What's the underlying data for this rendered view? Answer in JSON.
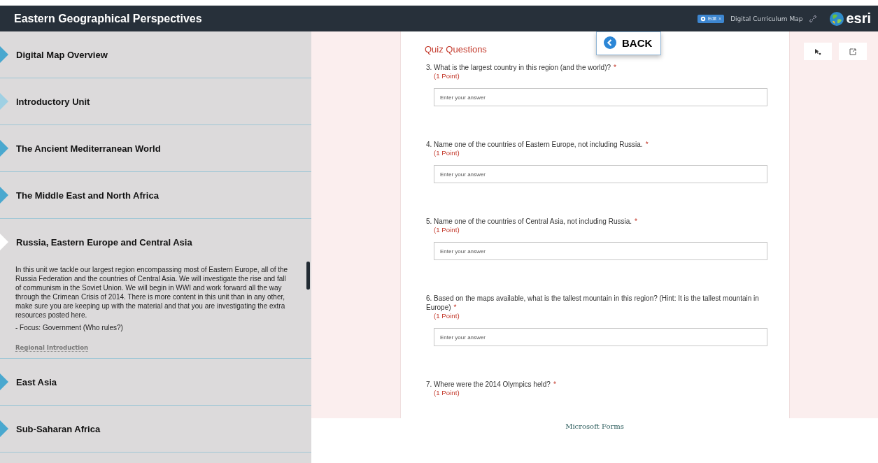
{
  "header": {
    "title": "Eastern Geographical Perspectives",
    "edit_button": "Edit",
    "edit_close": "×",
    "map_link": "Digital Curriculum Map",
    "logo": "esri"
  },
  "sidebar": {
    "items": [
      {
        "label": "Digital Map Overview",
        "color": "#4aa8cf",
        "expanded": false
      },
      {
        "label": "Introductory Unit",
        "color": "#9fd0e3",
        "expanded": false
      },
      {
        "label": "The Ancient Mediterranean World",
        "color": "#4aa8cf",
        "expanded": false
      },
      {
        "label": "The Middle East and North Africa",
        "color": "#4aa8cf",
        "expanded": false
      },
      {
        "label": "Russia, Eastern Europe and Central Asia",
        "color": "#ffffff",
        "expanded": true,
        "description": "In this unit we tackle our largest region encompassing most of Eastern Europe, all of the Russia Federation and the countries of Central Asia. We will investigate the rise and fall of communism in the Soviet Union. We will begin in WWI and work forward all the way through the Crimean Crisis of 2014. There is more content in this unit than in any other, make sure you are keeping up with the material and that you are investigating the extra resources posted here.",
        "focus": "- Focus: Government (Who rules?)",
        "link": "Regional Introduction"
      },
      {
        "label": "East Asia",
        "color": "#4aa8cf",
        "expanded": false
      },
      {
        "label": "Sub-Saharan Africa",
        "color": "#4aa8cf",
        "expanded": false
      }
    ]
  },
  "back_button": "BACK",
  "form": {
    "section_title": "Quiz Questions",
    "questions": [
      {
        "number": "3.",
        "text": "What is the largest country in this region (and the world)?",
        "required_mark": "*",
        "points": "(1 Point)",
        "placeholder": "Enter your answer"
      },
      {
        "number": "4.",
        "text": "Name one of the countries of Eastern Europe, not including Russia.",
        "required_mark": "*",
        "points": "(1 Point)",
        "placeholder": "Enter your answer"
      },
      {
        "number": "5.",
        "text": "Name one of the countries of Central Asia, not including Russia.",
        "required_mark": "*",
        "points": "(1 Point)",
        "placeholder": "Enter your answer"
      },
      {
        "number": "6.",
        "text": "Based on the maps available, what is the tallest mountain in this region? (Hint: It is the tallest mountain in Europe)",
        "required_mark": "*",
        "points": "(1 Point)",
        "placeholder": "Enter your answer"
      },
      {
        "number": "7.",
        "text": "Where were the 2014 Olympics held?",
        "required_mark": "*",
        "points": "(1 Point)"
      }
    ],
    "footer": "Microsoft Forms"
  }
}
